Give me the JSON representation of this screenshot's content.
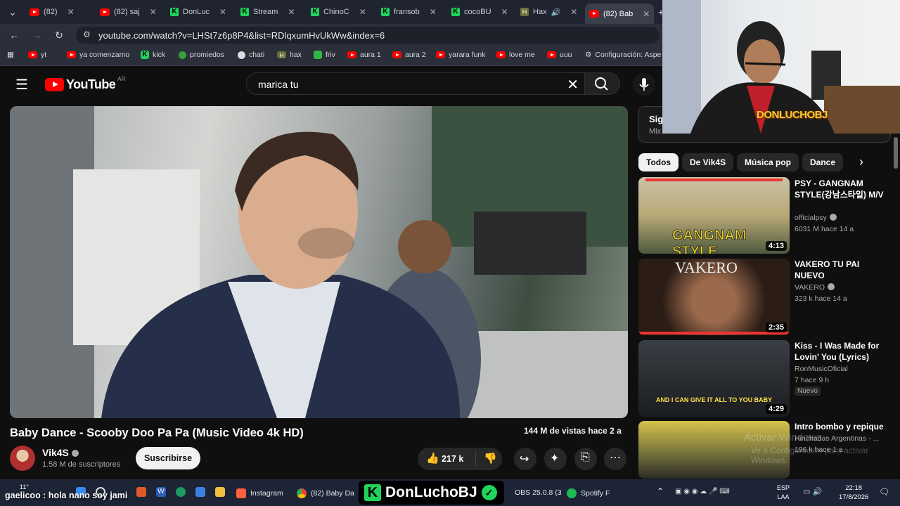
{
  "browser": {
    "tabs": [
      {
        "label": "(82)",
        "icon": "youtube"
      },
      {
        "label": "(82) saj",
        "icon": "youtube"
      },
      {
        "label": "DonLuc",
        "icon": "kick"
      },
      {
        "label": "Stream",
        "icon": "kick"
      },
      {
        "label": "ChinoC",
        "icon": "kick"
      },
      {
        "label": "fransob",
        "icon": "kick"
      },
      {
        "label": "cocoBU",
        "icon": "kick"
      },
      {
        "label": "Hax",
        "icon": "hax"
      },
      {
        "label": "(82) Bab",
        "icon": "youtube"
      }
    ],
    "url": "youtube.com/watch?v=LHSt7z6p8P4&list=RDlqxumHvUkWw&index=6",
    "bookmarks": [
      {
        "label": "yt",
        "icon": "youtube"
      },
      {
        "label": "ya comenzamo",
        "icon": "youtube"
      },
      {
        "label": "kick",
        "icon": "kick"
      },
      {
        "label": "promiedos",
        "icon": "promiedos"
      },
      {
        "label": "chati",
        "icon": "chat"
      },
      {
        "label": "hax",
        "icon": "hax"
      },
      {
        "label": "friv",
        "icon": "friv"
      },
      {
        "label": "aura 1",
        "icon": "youtube"
      },
      {
        "label": "aura 2",
        "icon": "youtube"
      },
      {
        "label": "yarara funk",
        "icon": "youtube"
      },
      {
        "label": "love me",
        "icon": "youtube"
      },
      {
        "label": "uuu",
        "icon": "youtube"
      },
      {
        "label": "Configuración: Aspe",
        "icon": "gear"
      }
    ]
  },
  "youtube": {
    "logo_text": "YouTube",
    "country": "AR",
    "search_value": "marica tu",
    "video": {
      "title": "Baby Dance - Scooby Doo Pa Pa (Music Video 4k HD)",
      "views": "144 M de vistas  hace 2 a",
      "channel": "Vik4S",
      "subscribers": "1.58 M de suscriptores",
      "subscribe_label": "Suscribirse",
      "likes": "217 k"
    },
    "mix": {
      "title": "Sigu",
      "subtitle": "Mix"
    },
    "chips": [
      "Todos",
      "De Vik4S",
      "Música pop",
      "Dance"
    ],
    "related": [
      {
        "title": "PSY - GANGNAM STYLE(강남스타일) M/V",
        "channel": "officialpsy",
        "verified": true,
        "meta": "6031 M  hace 14 a",
        "duration": "4:13",
        "badge": ""
      },
      {
        "title": "VAKERO  TU PAI NUEVO",
        "channel": "VAKERO",
        "verified": true,
        "meta": "323 k  hace 14 a",
        "duration": "2:35",
        "badge": ""
      },
      {
        "title": "Kiss - I Was Made for Lovin' You (Lyrics)",
        "channel": "RonMusicOficial",
        "verified": false,
        "meta": "7  hace 9 h",
        "duration": "4:29",
        "badge": "Nuevo"
      },
      {
        "title": "Intro bombo y repique",
        "channel": "Hinchadas Argentinas - ...",
        "verified": false,
        "meta": "196 k  hace 1 a",
        "duration": "",
        "badge": ""
      }
    ],
    "thumb_texts": {
      "vakero": "VAKERO",
      "kiss": "AND I CAN GIVE IT ALL TO YOU BABY",
      "psy": "GANGNAM STYLE"
    }
  },
  "overlay": {
    "webcam_name": "DONLUCHOBJ",
    "streamer_name": "DonLuchoBJ",
    "chat_line": "gaelicoo : hola nano soy jami",
    "windows_watermark": "Activar Windows",
    "windows_watermark_sub": "Ve a Configuración para activar Windows."
  },
  "taskbar": {
    "weather": "11°",
    "apps": [
      "Instagram",
      "(82) Baby Da",
      "OBS 25.0.8 (3",
      "Spotify F"
    ],
    "lang": "ESP",
    "lang2": "LAA",
    "time": "22:18",
    "date": "17/8/2026"
  },
  "colors": {
    "yt_red": "#ff0000",
    "kick_green": "#1fd35b",
    "bg": "#0f0f0f",
    "taskbar": "#1c2436"
  }
}
